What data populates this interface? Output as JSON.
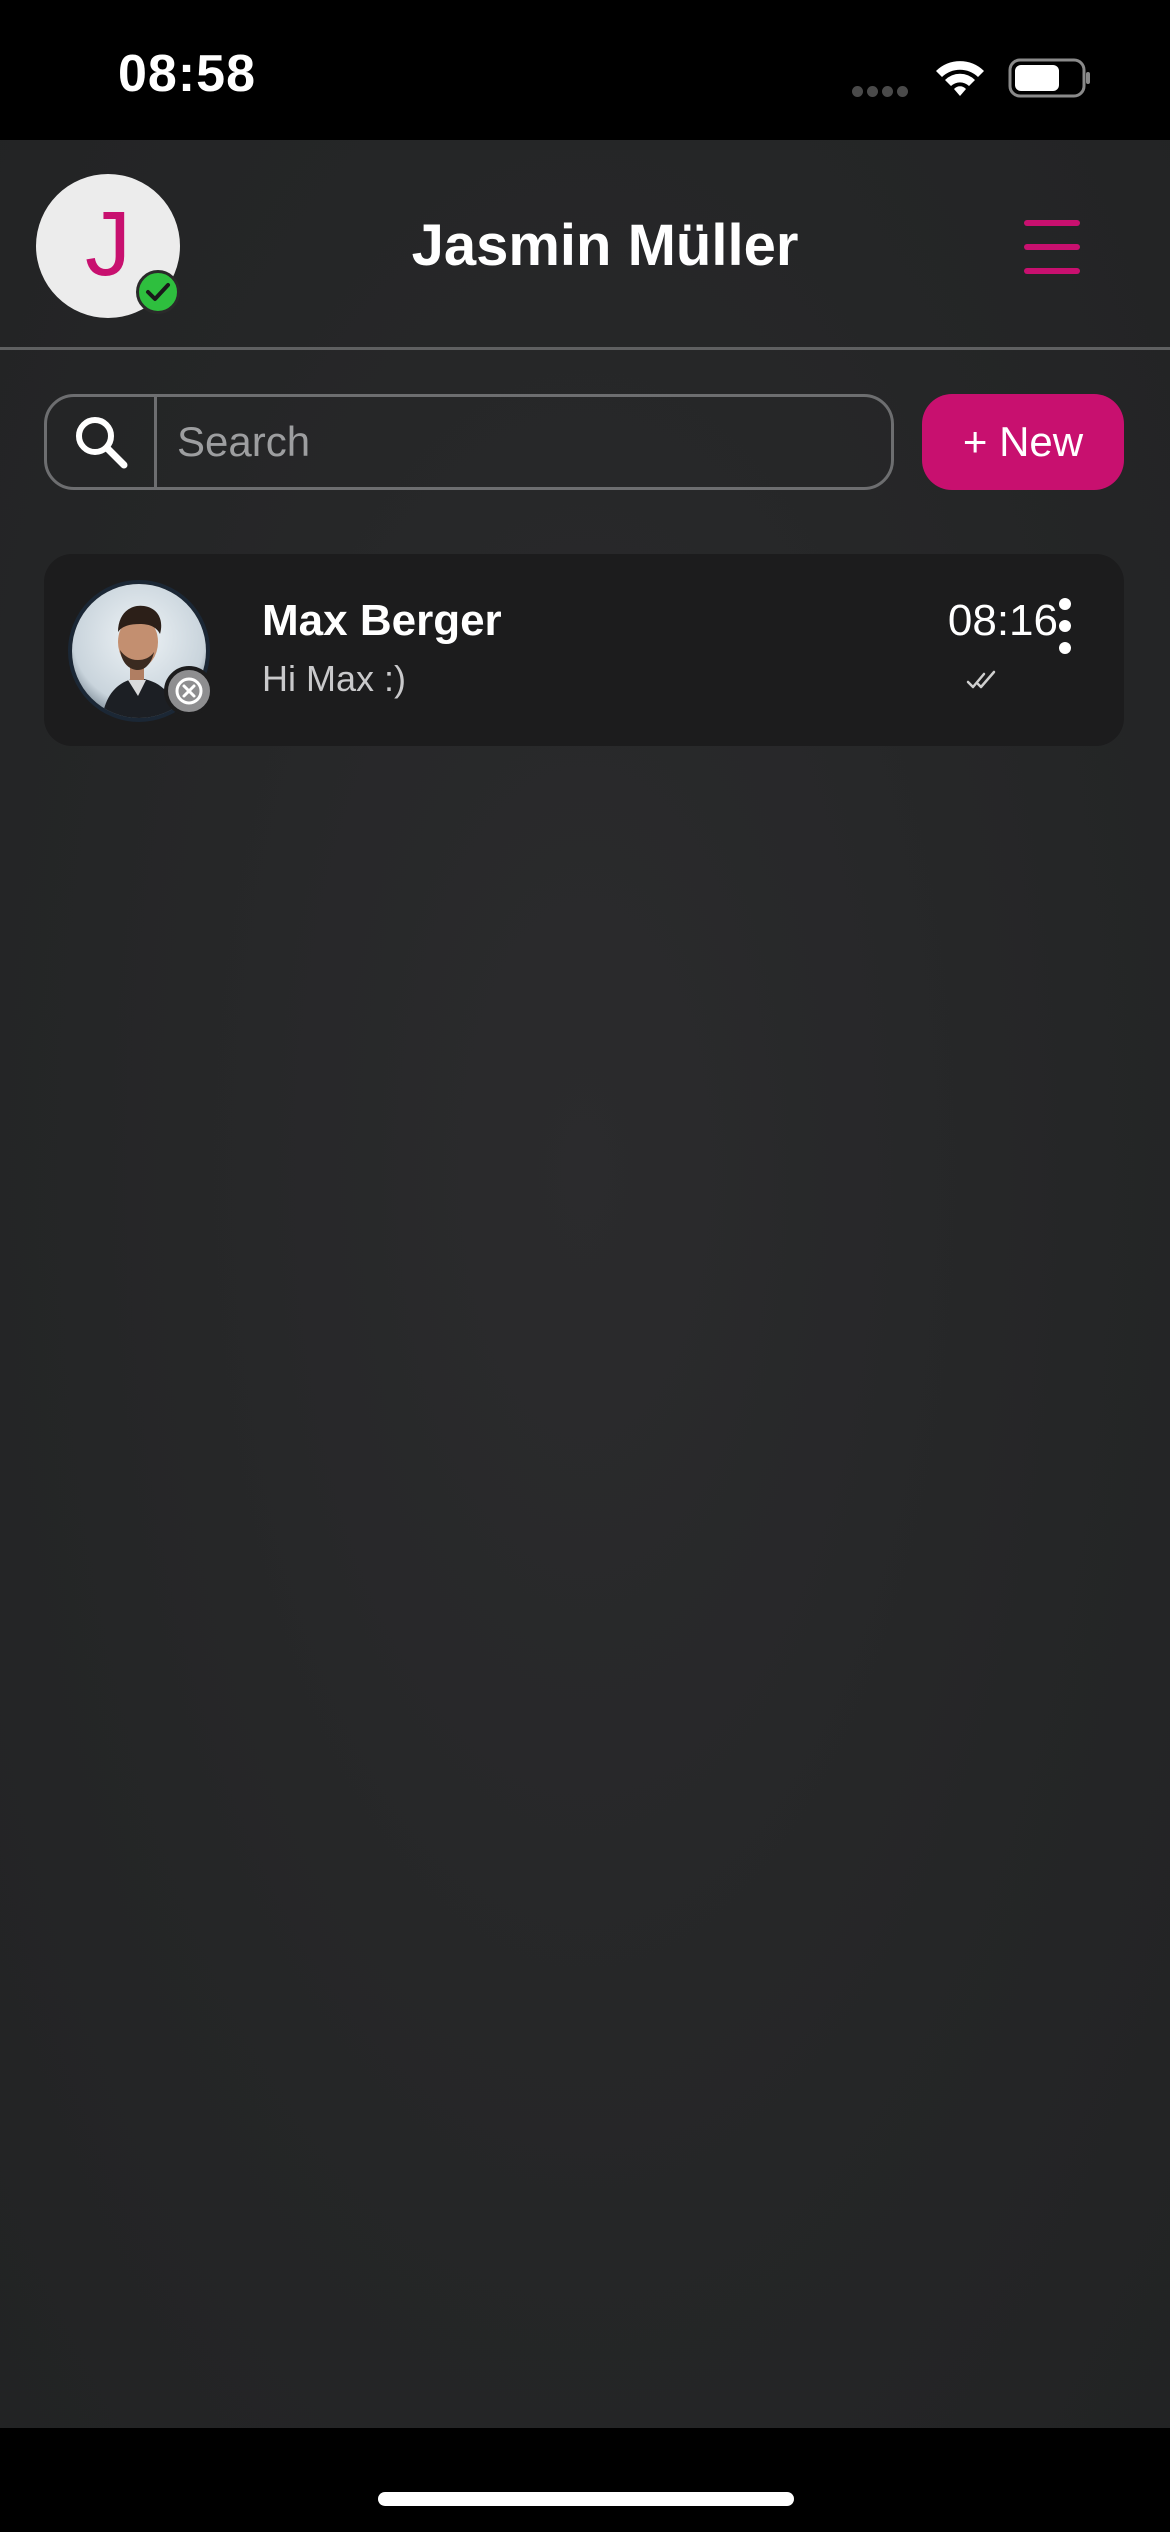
{
  "status_bar": {
    "time": "08:58"
  },
  "header": {
    "avatar_initial": "J",
    "title": "Jasmin Müller",
    "menu_icon": "hamburger-menu-icon",
    "online_icon": "check-icon"
  },
  "search": {
    "placeholder": "Search",
    "value": ""
  },
  "new_button": {
    "label": "+ New"
  },
  "chats": [
    {
      "name": "Max Berger",
      "last_message": "Hi Max :)",
      "time": "08:16",
      "status_icon": "offline-x-icon",
      "read_icon": "double-check-icon"
    }
  ],
  "colors": {
    "accent": "#c8106f",
    "online": "#2ebf3e",
    "background": "#252627",
    "card": "#1c1c1d"
  }
}
